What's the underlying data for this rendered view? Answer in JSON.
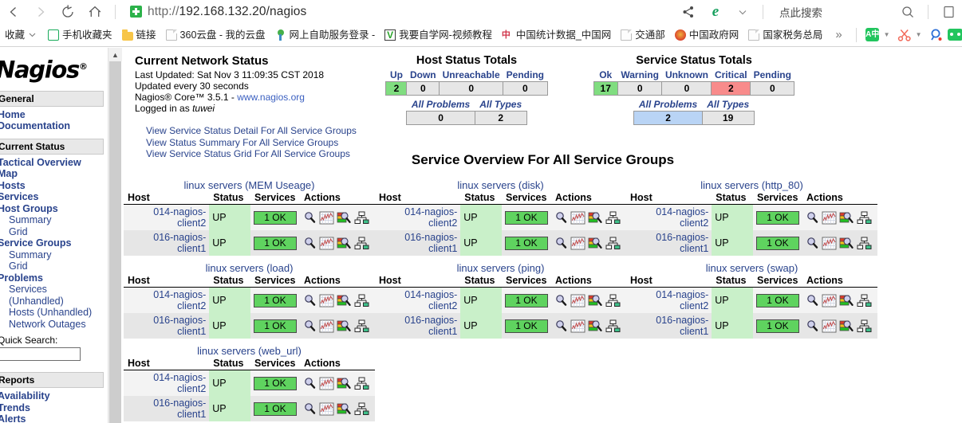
{
  "browser": {
    "back_label": "back-arrow",
    "forward_label": "forward-arrow",
    "reload_label": "reload",
    "home_label": "home",
    "url_scheme": "http://",
    "url_host": "192.168.132.20",
    "url_path": "/nagios",
    "search_placeholder": "点此搜索",
    "share_label": "share",
    "browser_engine_label": "e"
  },
  "bookmarks": {
    "items": [
      {
        "label": "收藏",
        "icon": "star-collection-icon",
        "caret": true
      },
      {
        "label": "手机收藏夹",
        "icon": "phone-icon"
      },
      {
        "label": "链接",
        "icon": "folder-icon"
      },
      {
        "label": "360云盘 - 我的云盘",
        "icon": "page-icon"
      },
      {
        "label": "网上自助服务登录 -",
        "icon": "tree-icon"
      },
      {
        "label": "我要自学网-视频教程",
        "icon": "v-logo-icon"
      },
      {
        "label": "中国统计数据_中国网",
        "icon": "cn-stats-icon"
      },
      {
        "label": "交通部",
        "icon": "page-icon"
      },
      {
        "label": "中国政府网",
        "icon": "gov-emblem-icon"
      },
      {
        "label": "国家税务总局",
        "icon": "page-icon"
      }
    ],
    "overflow_label": "»"
  },
  "sidebar": {
    "logo": "Nagios",
    "logo_mark": "®",
    "sections": [
      {
        "title": "General",
        "items": [
          {
            "label": "Home",
            "sub": false
          },
          {
            "label": "Documentation",
            "sub": false
          }
        ]
      },
      {
        "title": "Current Status",
        "items": [
          {
            "label": "Tactical Overview",
            "sub": false
          },
          {
            "label": "Map",
            "sub": false
          },
          {
            "label": "Hosts",
            "sub": false
          },
          {
            "label": "Services",
            "sub": false
          },
          {
            "label": "Host Groups",
            "sub": false
          },
          {
            "label": "Summary",
            "sub": true
          },
          {
            "label": "Grid",
            "sub": true
          },
          {
            "label": "Service Groups",
            "sub": false
          },
          {
            "label": "Summary",
            "sub": true
          },
          {
            "label": "Grid",
            "sub": true
          },
          {
            "label": "Problems",
            "sub": false
          },
          {
            "label": "Services",
            "sub": true
          },
          {
            "label": "(Unhandled)",
            "sub": true
          },
          {
            "label": "Hosts (Unhandled)",
            "sub": true
          },
          {
            "label": "Network Outages",
            "sub": true
          }
        ]
      }
    ],
    "quick_search_label": "Quick Search:",
    "quick_search_value": "",
    "reports_section": "Reports",
    "reports_items": [
      {
        "label": "Availability"
      },
      {
        "label": "Trends"
      },
      {
        "label": "Alerts"
      }
    ]
  },
  "status": {
    "current_network_status": "Current Network Status",
    "last_updated": "Last Updated: Sat Nov 3 11:09:35 CST 2018",
    "update_interval": "Updated every 30 seconds",
    "version_prefix": "Nagios® Core™ 3.5.1 - ",
    "version_link": "www.nagios.org",
    "logged_in_prefix": "Logged in as ",
    "logged_in_user": "tuwei",
    "links": [
      "View Service Status Detail For All Service Groups",
      "View Status Summary For All Service Groups",
      "View Service Status Grid For All Service Groups"
    ],
    "host_totals": {
      "title": "Host Status Totals",
      "headers": [
        "Up",
        "Down",
        "Unreachable",
        "Pending"
      ],
      "values": [
        "2",
        "0",
        "0",
        "0"
      ],
      "sub_headers": [
        "All Problems",
        "All Types"
      ],
      "sub_values": [
        "0",
        "2"
      ]
    },
    "service_totals": {
      "title": "Service Status Totals",
      "headers": [
        "Ok",
        "Warning",
        "Unknown",
        "Critical",
        "Pending"
      ],
      "values": [
        "17",
        "0",
        "0",
        "2",
        "0"
      ],
      "sub_headers": [
        "All Problems",
        "All Types"
      ],
      "sub_values": [
        "2",
        "19"
      ]
    }
  },
  "main": {
    "overview_title": "Service Overview For All Service Groups",
    "columns": [
      "Host",
      "Status",
      "Services",
      "Actions"
    ],
    "action_icons": [
      "magnifier-icon",
      "trends-graph-icon",
      "status-detail-icon",
      "network-map-icon"
    ],
    "groups": [
      {
        "title": "linux servers (MEM Useage)",
        "rows": [
          {
            "host": "014-nagios-client2",
            "status": "UP",
            "services": "1 OK"
          },
          {
            "host": "016-nagios-client1",
            "status": "UP",
            "services": "1 OK"
          }
        ]
      },
      {
        "title": "linux servers (disk)",
        "rows": [
          {
            "host": "014-nagios-client2",
            "status": "UP",
            "services": "1 OK"
          },
          {
            "host": "016-nagios-client1",
            "status": "UP",
            "services": "1 OK"
          }
        ]
      },
      {
        "title": "linux servers (http_80)",
        "rows": [
          {
            "host": "014-nagios-client2",
            "status": "UP",
            "services": "1 OK"
          },
          {
            "host": "016-nagios-client1",
            "status": "UP",
            "services": "1 OK"
          }
        ]
      },
      {
        "title": "linux servers (load)",
        "rows": [
          {
            "host": "014-nagios-client2",
            "status": "UP",
            "services": "1 OK"
          },
          {
            "host": "016-nagios-client1",
            "status": "UP",
            "services": "1 OK"
          }
        ]
      },
      {
        "title": "linux servers (ping)",
        "rows": [
          {
            "host": "014-nagios-client2",
            "status": "UP",
            "services": "1 OK"
          },
          {
            "host": "016-nagios-client1",
            "status": "UP",
            "services": "1 OK"
          }
        ]
      },
      {
        "title": "linux servers (swap)",
        "rows": [
          {
            "host": "014-nagios-client2",
            "status": "UP",
            "services": "1 OK"
          },
          {
            "host": "016-nagios-client1",
            "status": "UP",
            "services": "1 OK"
          }
        ]
      },
      {
        "title": "linux servers (web_url)",
        "rows": [
          {
            "host": "014-nagios-client2",
            "status": "UP",
            "services": "1 OK"
          },
          {
            "host": "016-nagios-client1",
            "status": "UP",
            "services": "1 OK"
          }
        ]
      }
    ]
  },
  "colors": {
    "ok_green": "#5fd35f",
    "status_green": "#c9f0c9",
    "critical_red": "#f88b8b",
    "problems_blue": "#b9d4f5",
    "link_blue": "#29438c"
  }
}
